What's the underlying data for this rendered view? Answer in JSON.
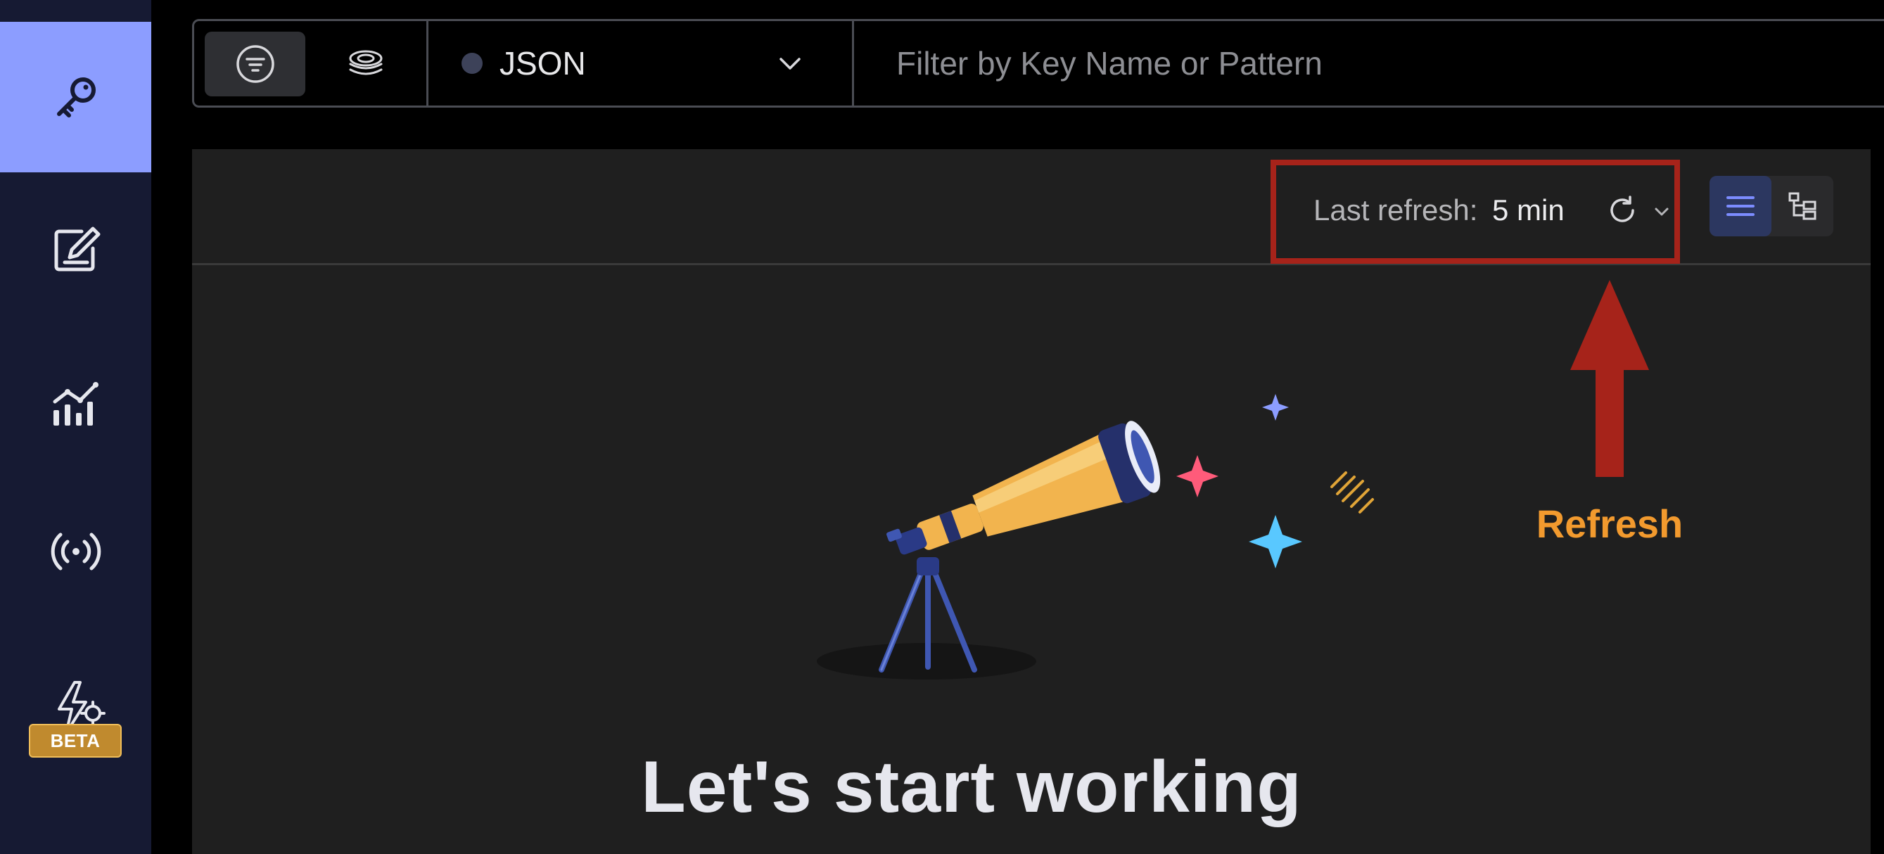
{
  "sidebar": {
    "items": [
      {
        "id": "browser",
        "icon": "key-icon",
        "active": true
      },
      {
        "id": "workbench",
        "icon": "edit-icon",
        "active": false
      },
      {
        "id": "analytics",
        "icon": "analytics-icon",
        "active": false
      },
      {
        "id": "pubsub",
        "icon": "broadcast-icon",
        "active": false
      },
      {
        "id": "triggers",
        "icon": "lightning-gear-icon",
        "active": false,
        "badge": "BETA"
      }
    ]
  },
  "toolbar": {
    "filter_mode_icon": "filter-icon",
    "search_mode_icon": "redisearch-icon",
    "type_select": {
      "selected": "JSON",
      "dot_color": "#3d4259"
    },
    "search": {
      "value": "",
      "placeholder": "Filter by Key Name or Pattern"
    }
  },
  "panel": {
    "refresh": {
      "label": "Last refresh:",
      "value": "5 min"
    },
    "view_modes": [
      {
        "id": "list",
        "icon": "list-view-icon",
        "active": true
      },
      {
        "id": "tree",
        "icon": "tree-view-icon",
        "active": false
      }
    ],
    "empty_state": {
      "title": "Let's start working"
    }
  },
  "annotation": {
    "label": "Refresh",
    "color": "#f29a2e",
    "box_color": "#a6231a"
  },
  "colors": {
    "sidebar_bg": "#161a33",
    "sidebar_active": "#8c9dff",
    "panel_bg": "#1f1f1f",
    "accent": "#6b7cff"
  }
}
